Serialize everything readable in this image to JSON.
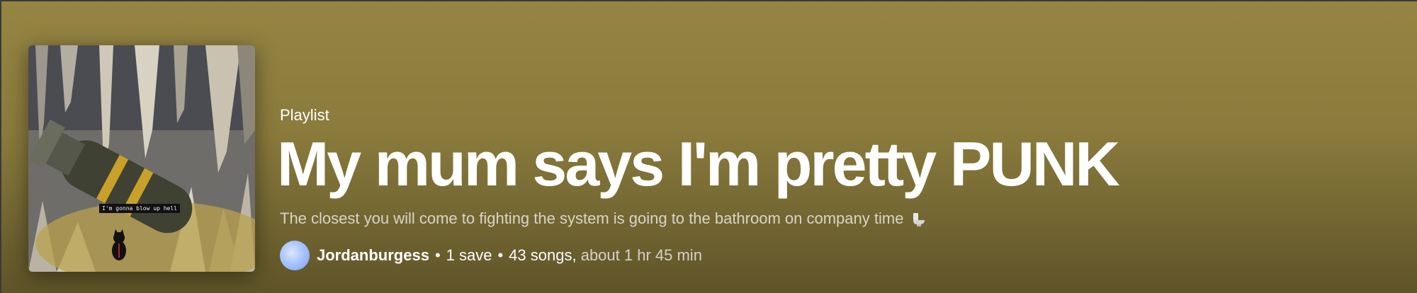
{
  "cover": {
    "caption": "I'm gonna blow up hell"
  },
  "playlist": {
    "type_label": "Playlist",
    "title": "My mum says I'm pretty PUNK",
    "description": "The closest you will come to fighting the system is going to the bathroom on company time",
    "description_icon": "toilet-icon"
  },
  "meta": {
    "owner": "Jordanburgess",
    "separator": "•",
    "saves": "1 save",
    "songs": "43 songs,",
    "duration": "about 1 hr 45 min"
  },
  "colors": {
    "header_top": "#958543",
    "header_bottom": "#5f5428",
    "text": "#ffffff"
  }
}
